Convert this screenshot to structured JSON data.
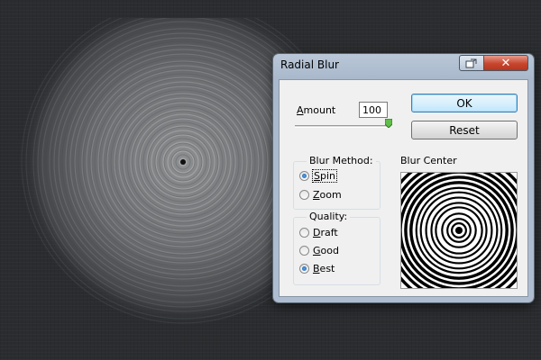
{
  "dialog": {
    "title": "Radial Blur",
    "close_symbol": "✕",
    "restore_icon": "restore-window-icon"
  },
  "amount": {
    "label_underlined": "A",
    "label_rest": "mount",
    "value": "100",
    "slider_fraction": 1.0
  },
  "buttons": {
    "ok_label": "OK",
    "reset_label": "Reset"
  },
  "blur_method": {
    "title": "Blur Method:",
    "options": [
      {
        "underlined": "S",
        "rest": "pin",
        "selected": true
      },
      {
        "underlined": "Z",
        "rest": "oom",
        "selected": false
      }
    ]
  },
  "quality": {
    "title": "Quality:",
    "options": [
      {
        "underlined": "D",
        "rest": "raft",
        "selected": false
      },
      {
        "underlined": "G",
        "rest": "ood",
        "selected": false
      },
      {
        "underlined": "B",
        "rest": "est",
        "selected": true
      }
    ]
  },
  "blur_center": {
    "label": "Blur Center"
  },
  "colors": {
    "canvas_background": "#2a2c2f",
    "close_button_red": "#c7452e",
    "ok_button_border": "#3c7fb1"
  }
}
